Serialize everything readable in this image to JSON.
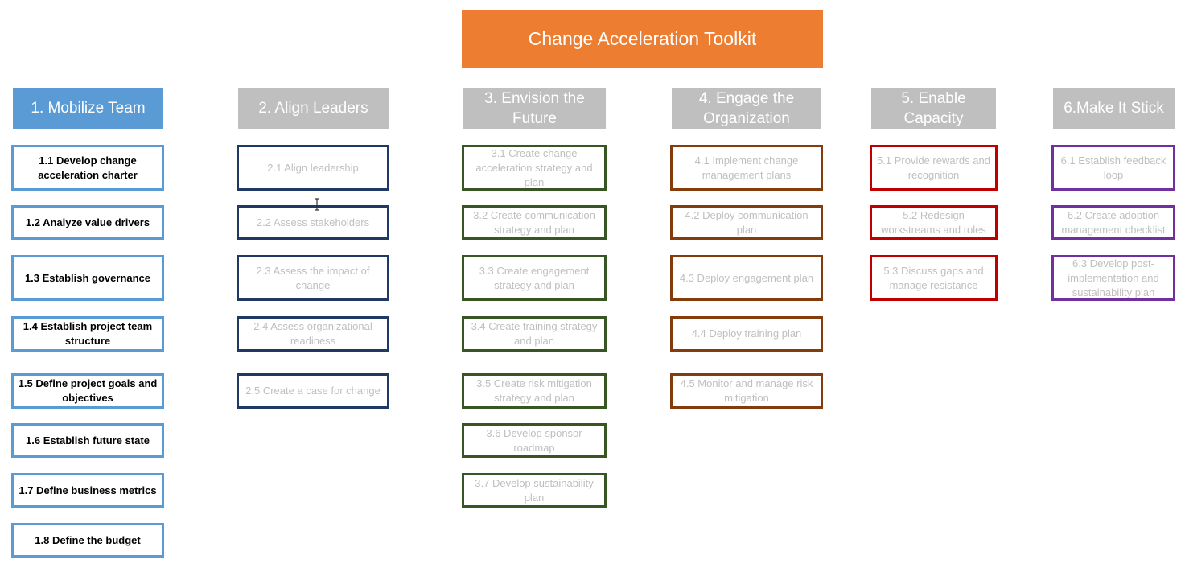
{
  "title": "Change Acceleration Toolkit",
  "colors": {
    "title_bg": "#ED7D31",
    "active_phase_bg": "#5B9BD5",
    "inactive_phase_bg": "#BFBFBF",
    "inactive_text": "#BFBFBF"
  },
  "phases": [
    {
      "label": "1. Mobilize Team",
      "active": true,
      "border_color": "#5B9BD5",
      "steps": [
        "1.1 Develop change acceleration charter",
        "1.2 Analyze value drivers",
        "1.3 Establish governance",
        "1.4 Establish project team structure",
        "1.5 Define project goals and objectives",
        "1.6 Establish future state",
        "1.7 Define business metrics",
        "1.8 Define the budget"
      ]
    },
    {
      "label": "2. Align Leaders",
      "active": false,
      "border_color": "#203864",
      "steps": [
        "2.1 Align leadership",
        "2.2 Assess stakeholders",
        "2.3 Assess the impact of change",
        "2.4 Assess organizational readiness",
        "2.5 Create a case for change"
      ]
    },
    {
      "label": "3. Envision the Future",
      "active": false,
      "border_color": "#375623",
      "steps": [
        "3.1 Create change acceleration strategy and plan",
        "3.2 Create communication strategy and plan",
        "3.3 Create engagement strategy and plan",
        "3.4 Create training strategy and plan",
        "3.5 Create risk mitigation strategy and plan",
        "3.6 Develop sponsor roadmap",
        "3.7 Develop sustainability plan"
      ]
    },
    {
      "label": "4. Engage the Organization",
      "active": false,
      "border_color": "#843C0C",
      "steps": [
        "4.1 Implement change management plans",
        "4.2 Deploy communication plan",
        "4.3 Deploy engagement plan",
        "4.4 Deploy training plan",
        "4.5 Monitor and manage risk mitigation"
      ]
    },
    {
      "label": "5. Enable Capacity",
      "active": false,
      "border_color": "#C00000",
      "steps": [
        "5.1 Provide rewards and recognition",
        "5.2 Redesign workstreams and roles",
        "5.3 Discuss gaps and manage resistance"
      ]
    },
    {
      "label": "6.Make It Stick",
      "active": false,
      "border_color": "#7030A0",
      "steps": [
        "6.1 Establish feedback loop",
        "6.2 Create adoption management checklist",
        "6.3 Develop post-implementation and sustainability plan"
      ]
    }
  ]
}
